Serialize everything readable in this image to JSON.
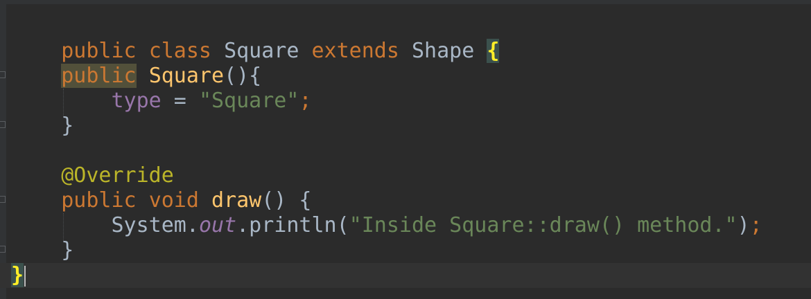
{
  "editor": {
    "language": "java",
    "colors": {
      "background": "#2b2b2b",
      "keyword": "#cc7832",
      "text": "#a9b7c6",
      "method": "#ffc66d",
      "field": "#9876aa",
      "string": "#6a8759",
      "annotation": "#bbb529",
      "brace_match": "#ffef28"
    },
    "lines": {
      "l1": {
        "kw_public": "public",
        "kw_class": "class",
        "name": "Square",
        "kw_extends": "extends",
        "parent": "Shape",
        "open_brace": "{"
      },
      "l3": {
        "kw_public": "public",
        "ctor": "Square",
        "rest": "(){"
      },
      "l4": {
        "field": "type",
        "op": " = ",
        "str": "\"Square\"",
        "semi": ";"
      },
      "l5": {
        "close": "}"
      },
      "l7": {
        "annotation": "@Override"
      },
      "l8": {
        "kw_public": "public",
        "kw_void": "void",
        "method": "draw",
        "rest": "() {"
      },
      "l9": {
        "sys": "System.",
        "out": "out",
        "call": ".println(",
        "str": "\"Inside Square::draw() method.\"",
        "paren": ")",
        "semi": ";"
      },
      "l10": {
        "close": "}"
      },
      "l11": {
        "close": "}"
      }
    }
  }
}
